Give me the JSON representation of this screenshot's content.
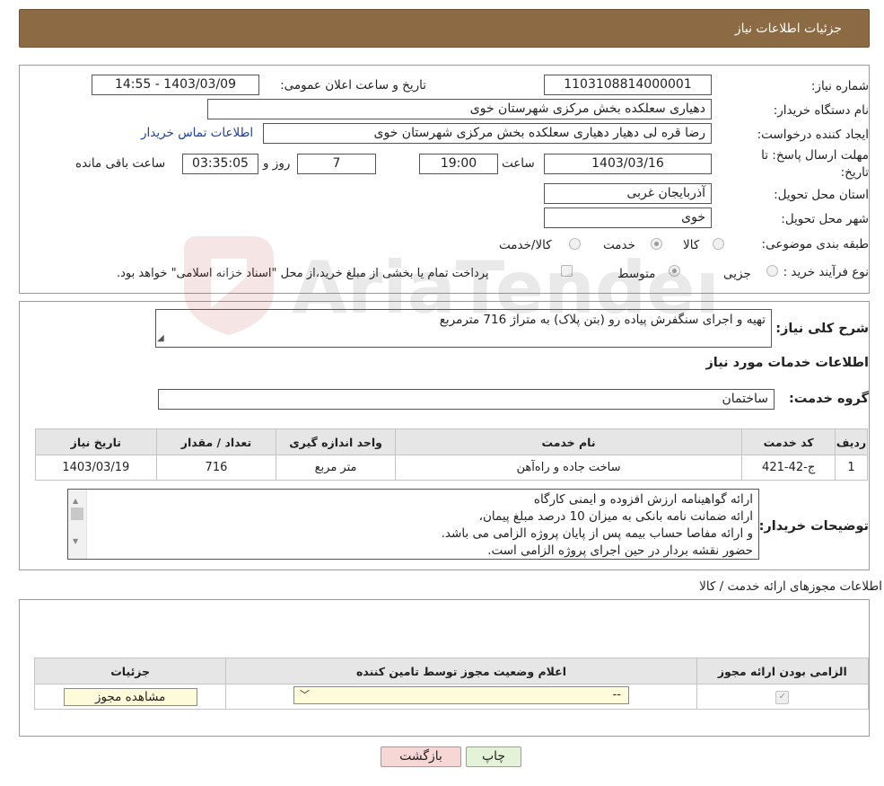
{
  "header": {
    "title": "جزئیات اطلاعات نیاز"
  },
  "form": {
    "need_number": {
      "label": "شماره نیاز:",
      "value": "1103108814000001"
    },
    "announce_datetime": {
      "label": "تاریخ و ساعت اعلان عمومی:",
      "value": "1403/03/09 - 14:55"
    },
    "buyer_org": {
      "label": "نام دستگاه خریدار:",
      "value": "دهیاری سعلکده بخش مرکزی شهرستان خوی"
    },
    "requester": {
      "label": "ایجاد کننده درخواست:",
      "value": "رضا قره لی دهیار دهیاری سعلکده بخش مرکزی شهرستان خوی",
      "contact_link": "اطلاعات تماس خریدار"
    },
    "deadline": {
      "label_line1": "مهلت ارسال پاسخ: تا",
      "label_line2": "تاریخ:",
      "date": "1403/03/16",
      "time_label": "ساعت",
      "time": "19:00",
      "days": "7",
      "days_label": "روز و",
      "remaining": "03:35:05",
      "remaining_label": "ساعت باقی مانده"
    },
    "province": {
      "label": "استان محل تحویل:",
      "value": "آذربایجان غربی"
    },
    "city": {
      "label": "شهر محل تحویل:",
      "value": "خوی"
    },
    "category": {
      "label": "طبقه بندی موضوعی:",
      "options": [
        "کالا",
        "خدمت",
        "کالا/خدمت"
      ],
      "selected": "خدمت"
    },
    "purchase_type": {
      "label": "نوع فرآیند خرید :",
      "options": [
        "جزیی",
        "متوسط"
      ],
      "selected": "متوسط",
      "payment_note": "پرداخت تمام یا بخشی از مبلغ خرید،از محل \"اسناد خزانه اسلامی\" خواهد بود."
    }
  },
  "summary": {
    "label": "شرح کلی نیاز:",
    "value": "تهیه و اجرای سنگفرش پیاده رو (بتن پلاک) به متراژ 716 مترمربع"
  },
  "services": {
    "section_title": "اطلاعات خدمات مورد نیاز",
    "group_label": "گروه خدمت:",
    "group_value": "ساختمان",
    "table": {
      "headers": [
        "ردیف",
        "کد خدمت",
        "نام خدمت",
        "واحد اندازه گیری",
        "تعداد / مقدار",
        "تاریخ نیاز"
      ],
      "rows": [
        [
          "1",
          "ج-42-421",
          "ساخت جاده و راه‌آهن",
          "متر مربع",
          "716",
          "1403/03/19"
        ]
      ]
    },
    "buyer_notes_label": "توضیحات خریدار:",
    "buyer_notes": [
      "ارائه گواهینامه ارزش افزوده و ایمنی کارگاه",
      "ارائه ضمانت نامه بانکی به میزان 10 درصد مبلغ پیمان،",
      "و ارائه مفاصا حساب بیمه پس از پایان پروژه الزامی می باشد.",
      "حضور نقشه بردار در حین اجرای پروژه الزامی است."
    ]
  },
  "permits": {
    "section_title": "اطلاعات مجوزهای ارائه خدمت / کالا",
    "headers": [
      "الزامی بودن ارائه مجوز",
      "اعلام وضعیت مجوز توسط تامین کننده",
      "جزئیات"
    ],
    "row": {
      "select_value": "--",
      "view_button": "مشاهده مجوز"
    }
  },
  "buttons": {
    "print": "چاپ",
    "back": "بازگشت"
  },
  "watermark": {
    "text": "AriaTender.neT"
  },
  "colors": {
    "header_bg": "#8c6a43",
    "link": "#1b3fa6",
    "back_button_bg": "#f7d6d6",
    "print_button_bg": "#e4f2d8",
    "view_button_bg": "#fdfbd9"
  }
}
